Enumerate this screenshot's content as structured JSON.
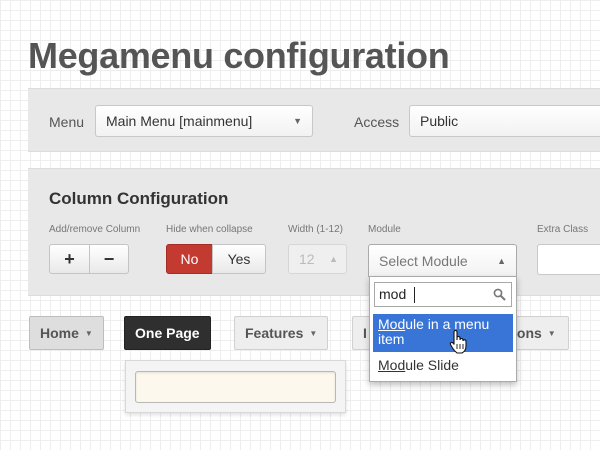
{
  "page_title": "Megamenu configuration",
  "menu_bar": {
    "menu_label": "Menu",
    "menu_value": "Main Menu [mainmenu]",
    "access_label": "Access",
    "access_value": "Public"
  },
  "column_config": {
    "title": "Column Configuration",
    "add_remove_label": "Add/remove Column",
    "add_symbol": "+",
    "remove_symbol": "−",
    "hide_label": "Hide when collapse",
    "no_label": "No",
    "yes_label": "Yes",
    "width_label": "Width (1-12)",
    "width_value": "12",
    "module_label": "Module",
    "module_placeholder": "Select Module",
    "extra_class_label": "Extra Class"
  },
  "module_dropdown": {
    "search_value": "mod",
    "options": [
      {
        "match": "Mod",
        "rest_line1": "ule in a menu",
        "rest_line2": "item"
      },
      {
        "match": "Mod",
        "rest": "ule Slide"
      }
    ]
  },
  "tabs": {
    "home": "Home",
    "one_page": "One Page",
    "features": "Features",
    "partial_left": "I",
    "partial_right": "ions"
  },
  "colors": {
    "accent_red": "#c33a30",
    "highlight_blue": "#3875d7",
    "dark_tab": "#2f2f2f"
  }
}
